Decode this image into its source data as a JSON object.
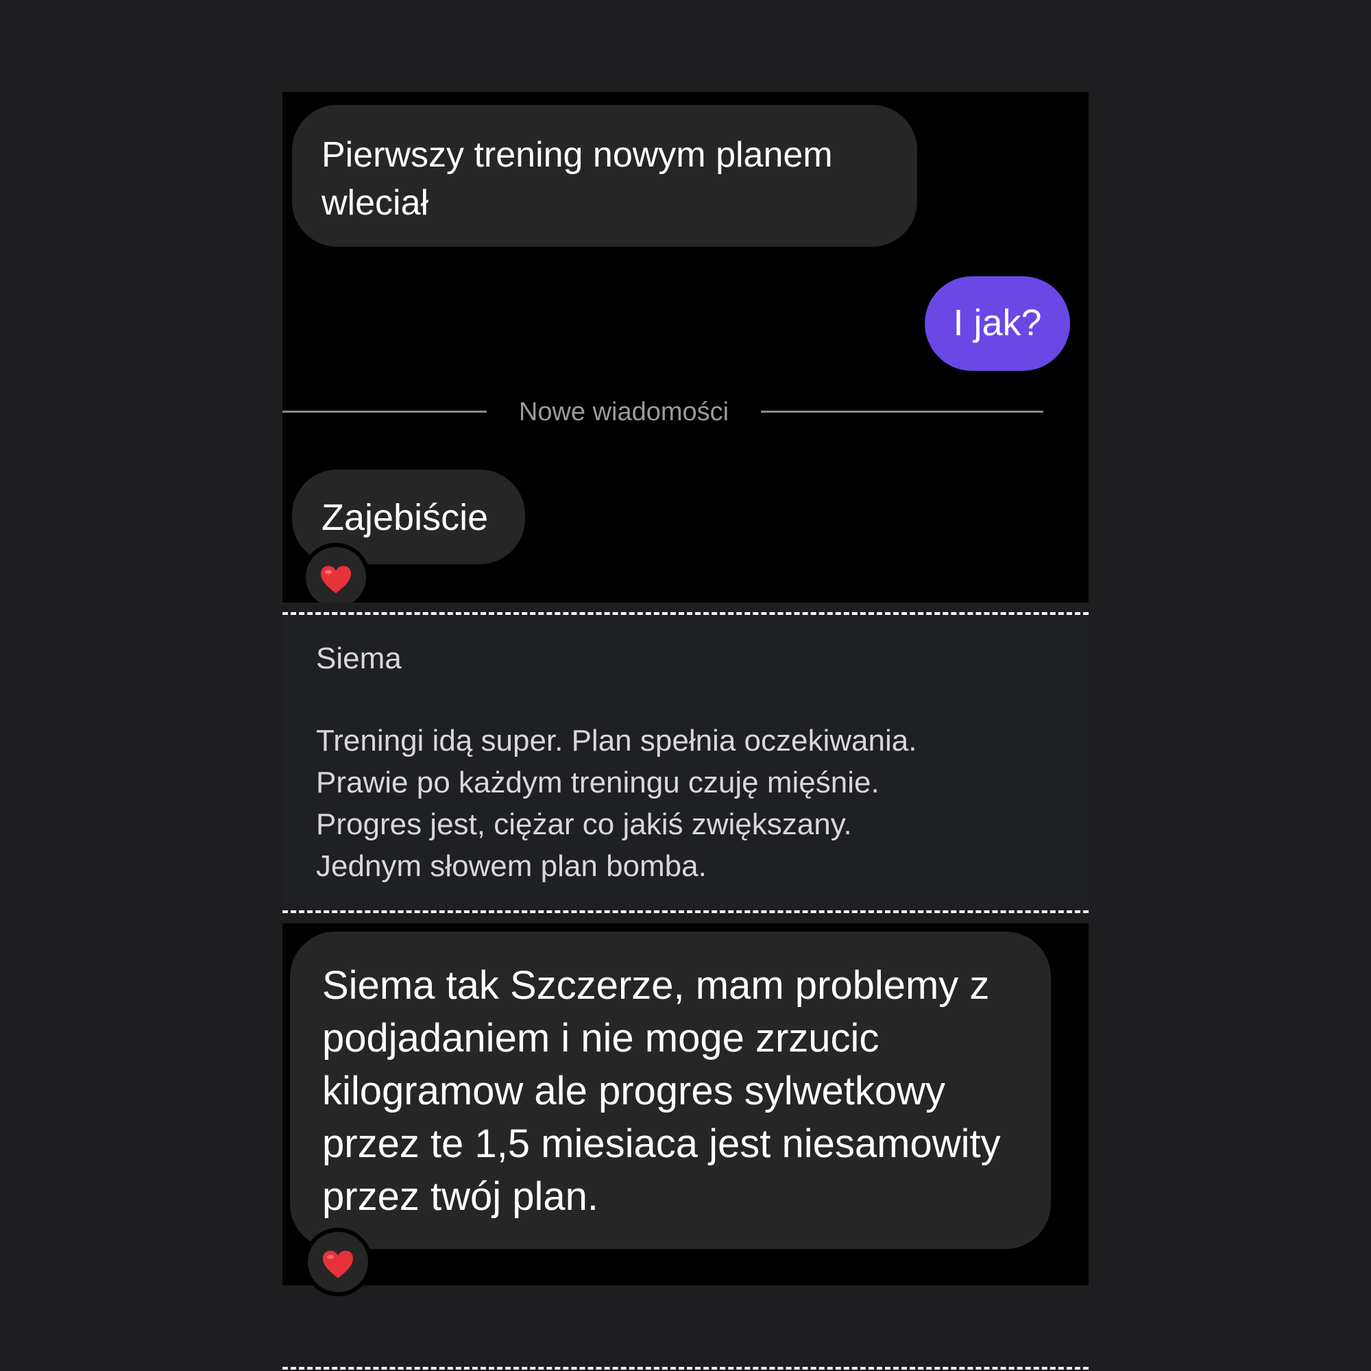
{
  "chat_top": {
    "messages": [
      {
        "direction": "incoming",
        "text": "Pierwszy trening nowym planem wleciał"
      },
      {
        "direction": "outgoing",
        "text": "I jak?"
      },
      {
        "direction": "incoming",
        "text": "Zajebiście",
        "reaction": "heart"
      }
    ],
    "divider_label": "Nowe wiadomości"
  },
  "quote": {
    "greeting": "Siema",
    "lines": [
      "Treningi idą super. Plan spełnia oczekiwania.",
      "Prawie po każdym treningu czuję mięśnie.",
      "Progres jest, ciężar co jakiś zwiększany.",
      "Jednym słowem plan bomba."
    ]
  },
  "chat_bottom": {
    "messages": [
      {
        "direction": "incoming",
        "text": "Siema tak Szczerze, mam problemy z podjadaniem i nie moge zrzucic kilogramow ale progres sylwetkowy przez te 1,5 miesiaca jest niesamowity przez twój plan.",
        "reaction": "heart"
      }
    ]
  },
  "colors": {
    "page_background": "#1e1e21",
    "chat_background": "#000000",
    "incoming_bubble": "#262626",
    "outgoing_bubble": "#6a48e6",
    "quote_background": "#1f2024",
    "heart": "#e8323a"
  },
  "icons": {
    "reaction": "heart-icon"
  }
}
